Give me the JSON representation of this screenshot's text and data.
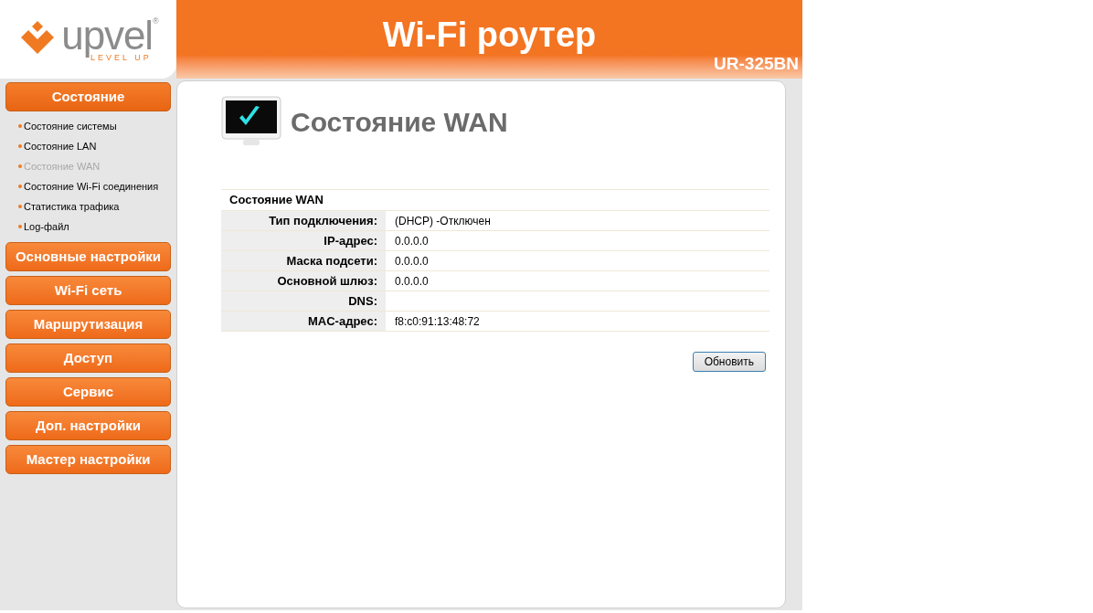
{
  "logo": {
    "brand": "upvel",
    "mark": "®",
    "tagline": "LEVEL UP"
  },
  "header": {
    "title": "Wi-Fi роутер",
    "model": "UR-325BN"
  },
  "sidebar": {
    "items": [
      {
        "label": "Состояние",
        "expanded": true,
        "children": [
          {
            "label": "Состояние системы",
            "selected": false
          },
          {
            "label": "Состояние LAN",
            "selected": false
          },
          {
            "label": "Состояние WAN",
            "selected": true
          },
          {
            "label": "Состояние Wi-Fi соединения",
            "selected": false
          },
          {
            "label": "Статистика трафика",
            "selected": false
          },
          {
            "label": "Log-файл",
            "selected": false
          }
        ]
      },
      {
        "label": "Основные настройки",
        "expanded": false
      },
      {
        "label": "Wi-Fi сеть",
        "expanded": false
      },
      {
        "label": "Маршрутизация",
        "expanded": false
      },
      {
        "label": "Доступ",
        "expanded": false
      },
      {
        "label": "Сервис",
        "expanded": false
      },
      {
        "label": "Доп. настройки",
        "expanded": false
      },
      {
        "label": "Мастер настройки",
        "expanded": false
      }
    ]
  },
  "page": {
    "title": "Состояние WAN"
  },
  "table": {
    "title": "Состояние WAN",
    "rows": [
      {
        "label": "Тип подключения:",
        "value": "(DHCP) -Отключен"
      },
      {
        "label": "IP-адрес:",
        "value": "0.0.0.0"
      },
      {
        "label": "Маска подсети:",
        "value": "0.0.0.0"
      },
      {
        "label": "Основной шлюз:",
        "value": "0.0.0.0"
      },
      {
        "label": "DNS:"
      },
      {
        "label": "MAC-адрес:",
        "value": "f8:c0:91:13:48:72"
      }
    ]
  },
  "buttons": [
    {
      "label": "Обновить"
    }
  ]
}
